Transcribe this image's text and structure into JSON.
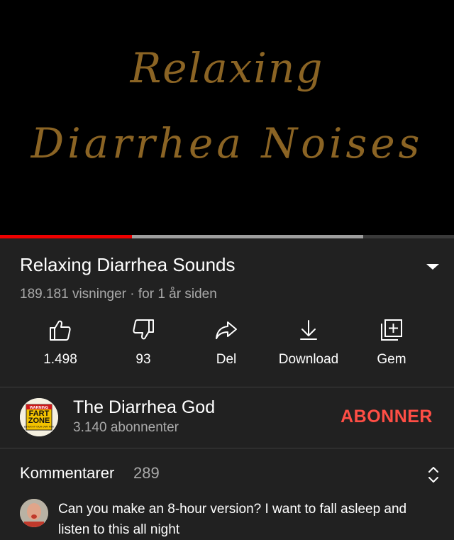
{
  "video": {
    "thumbnail_line1": "Relaxing",
    "thumbnail_line2": "Diarrhea Noises",
    "played_fraction": 0.29,
    "buffered_fraction": 0.8
  },
  "title": "Relaxing Diarrhea Sounds",
  "meta": "189.181 visninger · for 1 år siden",
  "actions": {
    "like": "1.498",
    "dislike": "93",
    "share": "Del",
    "download": "Download",
    "save": "Gem"
  },
  "channel": {
    "avatar_text_top": "WARNING",
    "avatar_text_main1": "FART",
    "avatar_text_main2": "ZONE",
    "avatar_text_small": "ENTER AT YOUR OWN RISK",
    "name": "The Diarrhea God",
    "subscribers": "3.140 abonnenter",
    "subscribe": "ABONNER"
  },
  "comments": {
    "header": "Kommentarer",
    "count": "289",
    "first": "Can you make an 8-hour version? I want to fall asleep and listen to this all night"
  },
  "colors": {
    "background": "#212121",
    "accent_red": "#ff4e45",
    "progress_red": "#ee0000",
    "thumbnail_gold": "#8b6424"
  }
}
